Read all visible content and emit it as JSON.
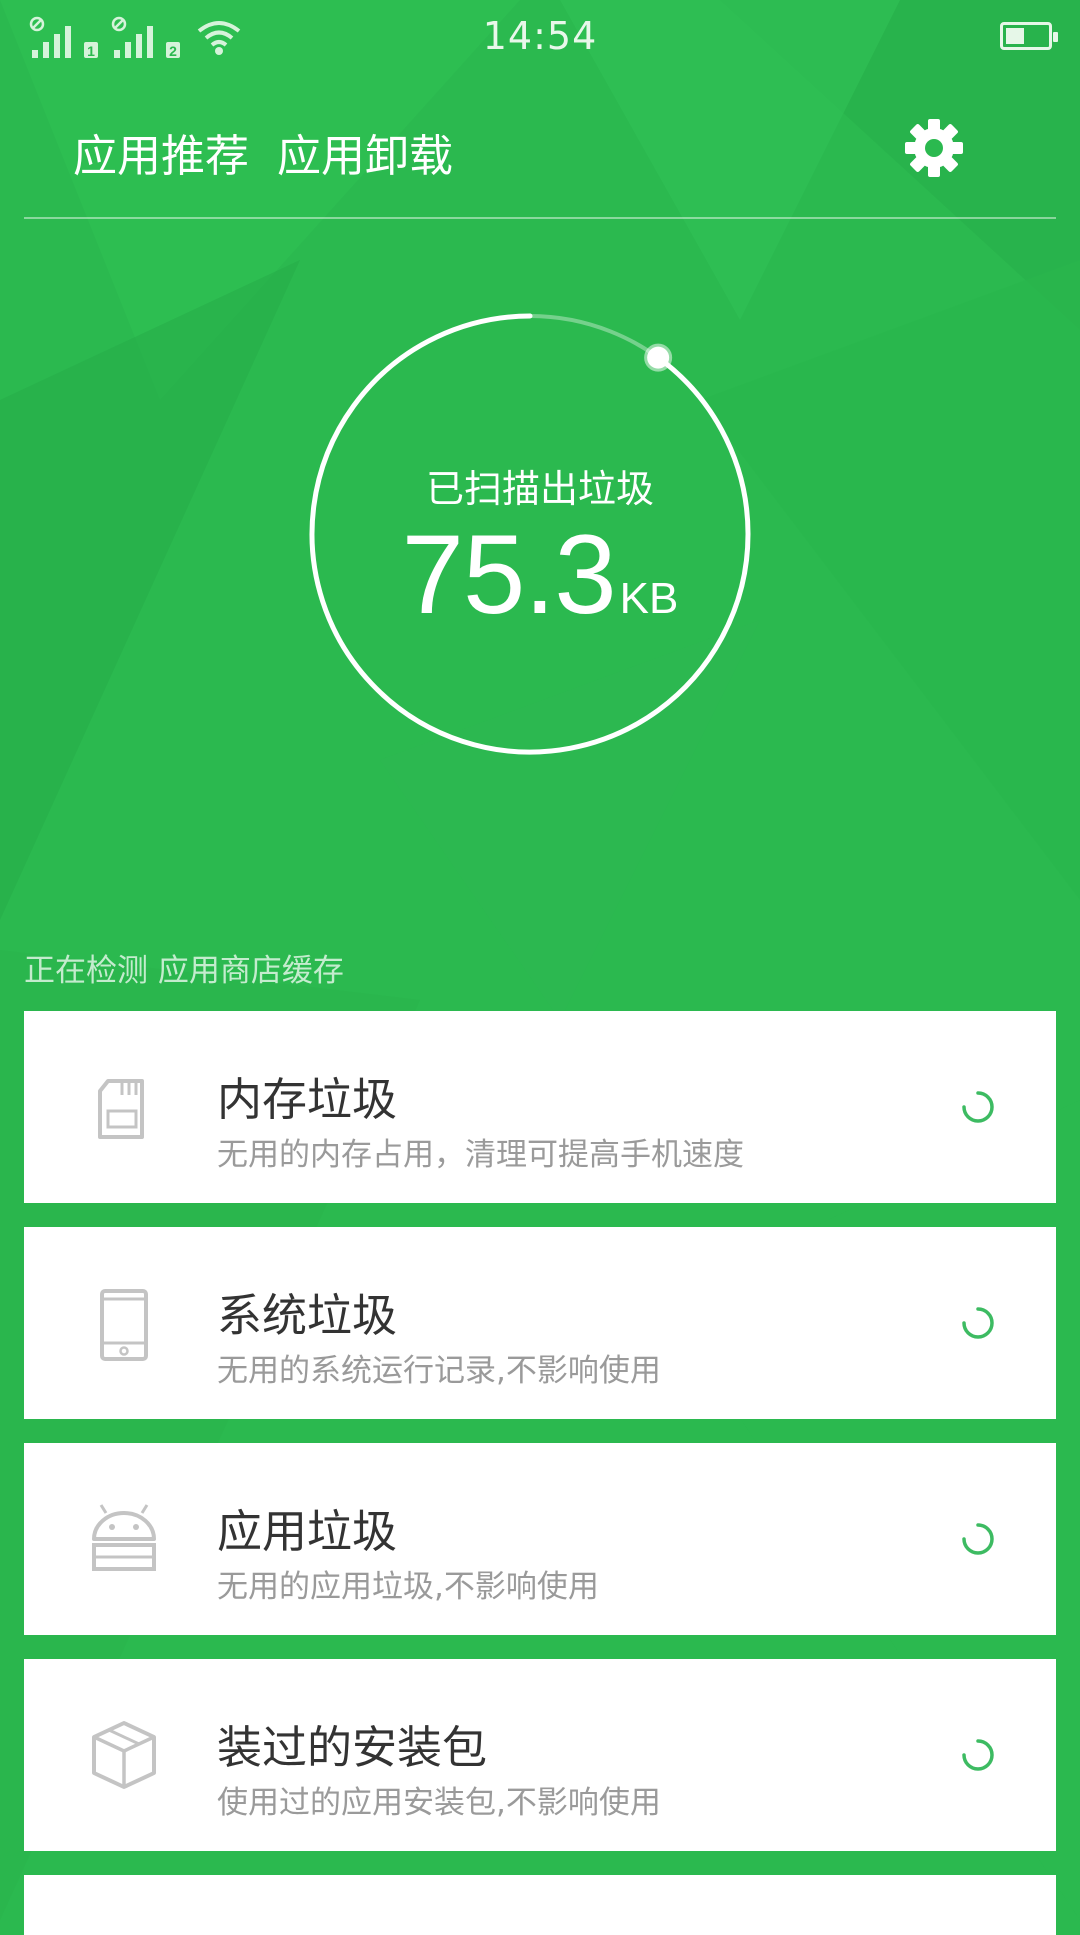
{
  "status_bar": {
    "time": "14:54",
    "sim1_label": "1",
    "sim2_label": "2",
    "battery_level": 0.45
  },
  "header": {
    "tabs": [
      {
        "label": "应用推荐"
      },
      {
        "label": "应用卸载"
      }
    ],
    "settings_icon": "gear-icon"
  },
  "scan": {
    "title": "已扫描出垃圾",
    "value": "75.3",
    "unit": "KB",
    "progress": 0.9,
    "status_text": "正在检测 应用商店缓存"
  },
  "categories": [
    {
      "title": "内存垃圾",
      "subtitle": "无用的内存占用，清理可提高手机速度",
      "icon": "sd-card-icon"
    },
    {
      "title": "系统垃圾",
      "subtitle": "无用的系统运行记录,不影响使用",
      "icon": "phone-icon"
    },
    {
      "title": "应用垃圾",
      "subtitle": "无用的应用垃圾,不影响使用",
      "icon": "android-icon"
    },
    {
      "title": "装过的安装包",
      "subtitle": "使用过的应用安装包,不影响使用",
      "icon": "package-icon"
    }
  ],
  "colors": {
    "background": "#2bb94f",
    "spinner": "#3dbb62",
    "card": "#ffffff",
    "icon_gray": "#c4c4c4"
  }
}
